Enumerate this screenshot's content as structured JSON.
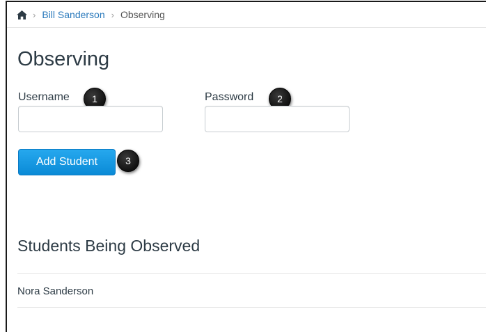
{
  "breadcrumb": {
    "home_icon": "home-icon",
    "separator": "›",
    "parent": "Bill Sanderson",
    "current": "Observing"
  },
  "page": {
    "title": "Observing"
  },
  "form": {
    "username_label": "Username",
    "username_value": "",
    "password_label": "Password",
    "password_value": "",
    "add_button_label": "Add Student"
  },
  "callouts": [
    "1",
    "2",
    "3"
  ],
  "students": {
    "heading": "Students Being Observed",
    "items": [
      "Nora Sanderson"
    ]
  },
  "colors": {
    "link": "#2b7abc",
    "button": "#1a9be3",
    "text": "#2d3b45"
  }
}
